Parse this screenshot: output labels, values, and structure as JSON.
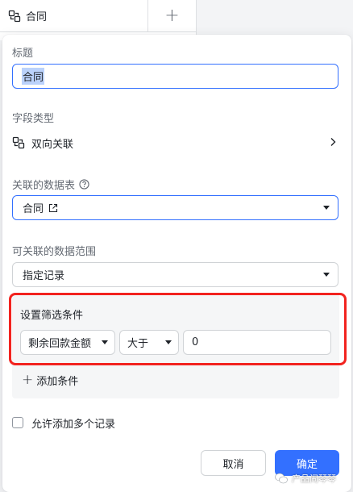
{
  "background": {
    "column_title": "合同",
    "add_column_glyph": "+"
  },
  "panel": {
    "title_label": "标题",
    "title_value": "合同",
    "field_type_label": "字段类型",
    "field_type_value": "双向关联",
    "linked_table_label": "关联的数据表",
    "linked_table_value": "合同",
    "range_label": "可关联的数据范围",
    "range_value": "指定记录",
    "filter": {
      "title": "设置筛选条件",
      "field": "剩余回款金额",
      "operator": "大于",
      "value": "0",
      "add_label": "添加条件"
    },
    "allow_multiple_label": "允许添加多个记录",
    "allow_multiple_checked": false,
    "cancel_label": "取消",
    "ok_label": "确定"
  },
  "watermark": {
    "text": "产品闹琴琴"
  },
  "colors": {
    "accent": "#3370ff",
    "highlight": "#f2231f",
    "selection": "#bbd2fb"
  }
}
